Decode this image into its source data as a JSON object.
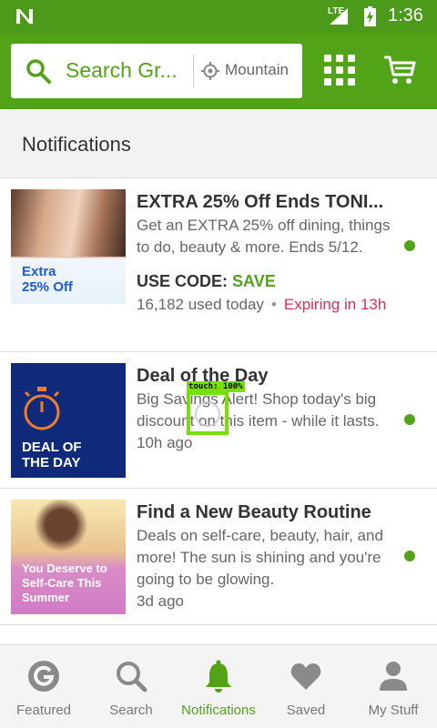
{
  "status_bar": {
    "network": "LTE",
    "time": "1:36"
  },
  "header": {
    "search_placeholder": "Search Gr...",
    "location": "Mountain",
    "icons": [
      "search-icon",
      "location-icon",
      "grid-icon",
      "cart-icon"
    ]
  },
  "section": {
    "title": "Notifications"
  },
  "notifications": [
    {
      "title": "EXTRA 25% Off Ends TONI...",
      "description": "Get an EXTRA 25% off dining, things to do, beauty & more. Ends 5/12.",
      "thumb_label": "Extra 25% Off",
      "code_label": "USE CODE:",
      "code": "SAVE",
      "used": "16,182 used today",
      "separator": "•",
      "expiring": "Expiring in 13h",
      "unread": true
    },
    {
      "title": "Deal of the Day",
      "description": "Big Savings Alert! Shop today's big discount on this item - while it lasts.",
      "thumb_label": "DEAL OF THE DAY",
      "time": "10h ago",
      "unread": true
    },
    {
      "title": "Find a New Beauty Routine",
      "description": "Deals on self-care, beauty, hair, and more! The sun is shining and you're going to be glowing.",
      "thumb_label": "You Deserve to Self-Care This Summer",
      "time": "3d ago",
      "unread": true
    }
  ],
  "touch_overlay": {
    "label": "touch: 100%"
  },
  "bottom_nav": {
    "items": [
      {
        "label": "Featured",
        "icon": "groupon-g-icon"
      },
      {
        "label": "Search",
        "icon": "search-icon"
      },
      {
        "label": "Notifications",
        "icon": "bell-icon",
        "active": true
      },
      {
        "label": "Saved",
        "icon": "heart-icon"
      },
      {
        "label": "My Stuff",
        "icon": "person-icon"
      }
    ]
  },
  "colors": {
    "brand_green": "#53a318",
    "status_green": "#4c9a1a",
    "expiring_red": "#d8305a",
    "touch_green": "#77e000"
  }
}
